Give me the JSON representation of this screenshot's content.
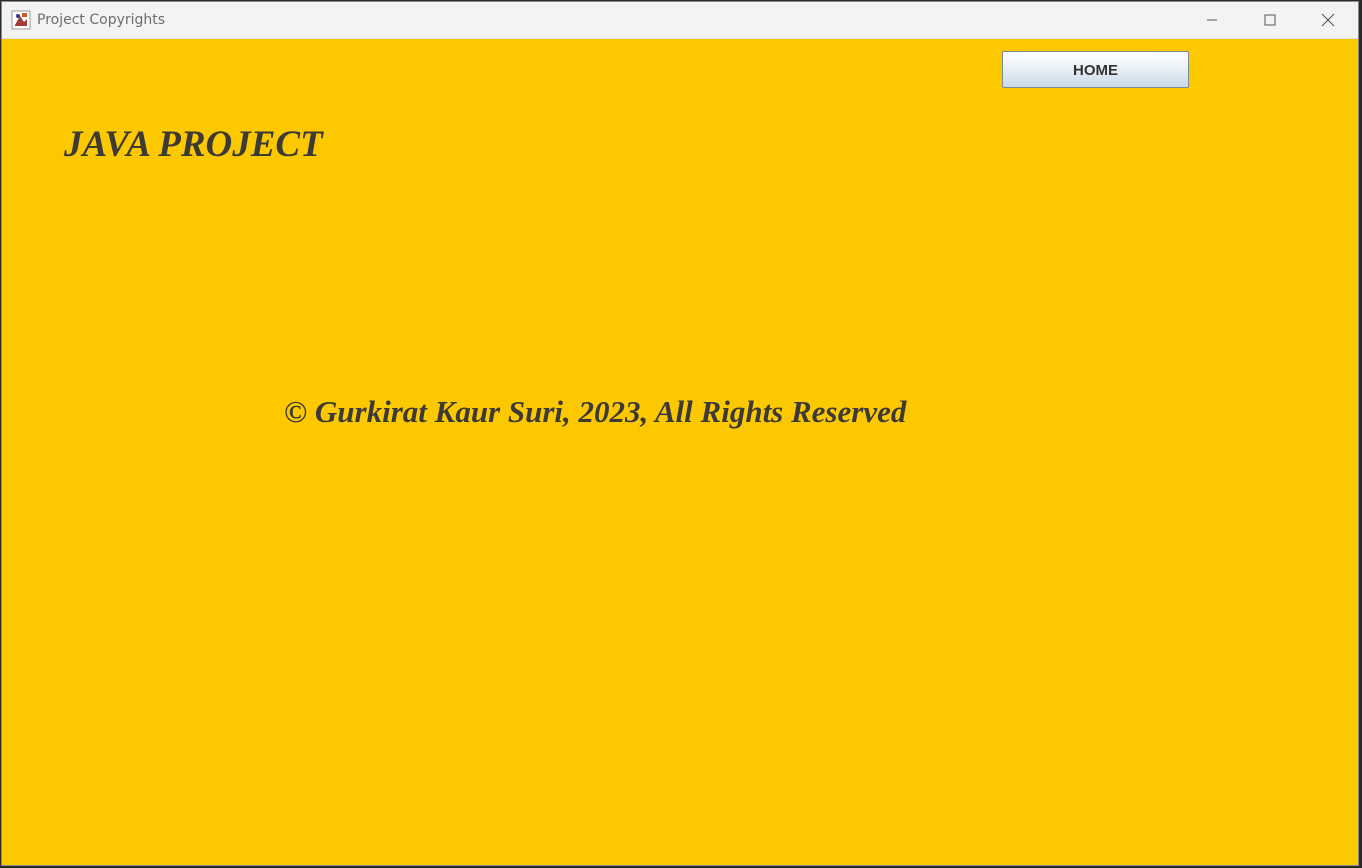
{
  "window": {
    "title": "Project Copyrights",
    "icon": "java-app-icon",
    "controls": {
      "minimize": "minimize-icon",
      "maximize": "maximize-icon",
      "close": "close-icon"
    }
  },
  "content": {
    "background_color": "#fcc800",
    "text_color": "#3d3a36",
    "home_button_label": "HOME",
    "project_title": "JAVA PROJECT",
    "copyright_text": "© Gurkirat Kaur Suri, 2023, All Rights Reserved"
  }
}
